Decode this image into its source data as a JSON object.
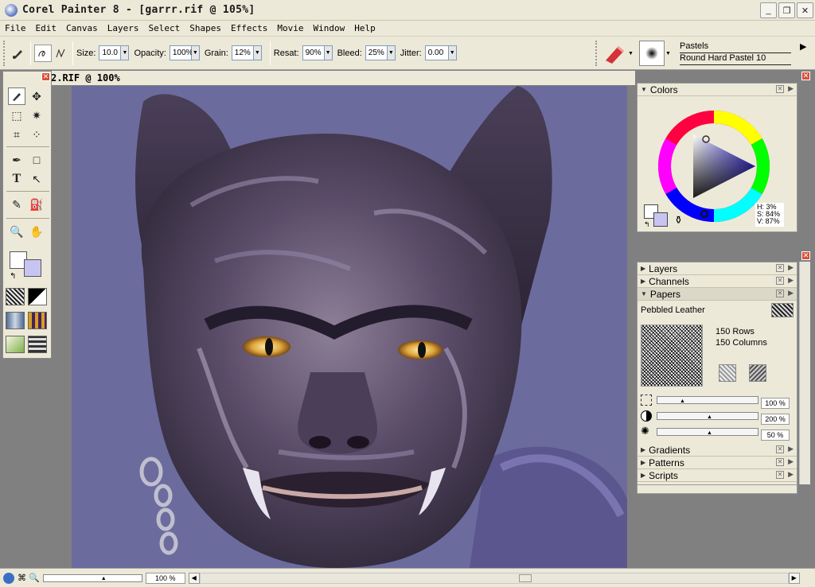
{
  "app": {
    "title": "Corel Painter 8 - [garrr.rif @ 105%]",
    "window_buttons": [
      "_",
      "❐",
      "✕"
    ]
  },
  "menu": [
    "File",
    "Edit",
    "Canvas",
    "Layers",
    "Select",
    "Shapes",
    "Effects",
    "Movie",
    "Window",
    "Help"
  ],
  "properties": {
    "size_label": "Size:",
    "size_value": "10.0",
    "opacity_label": "Opacity:",
    "opacity_value": "100%",
    "grain_label": "Grain:",
    "grain_value": "12%",
    "resat_label": "Resat:",
    "resat_value": "90%",
    "bleed_label": "Bleed:",
    "bleed_value": "25%",
    "jitter_label": "Jitter:",
    "jitter_value": "0.00"
  },
  "brush": {
    "category": "Pastels",
    "variant": "Round Hard Pastel 10"
  },
  "document": {
    "title": "2.RIF @ 100%"
  },
  "colors_panel": {
    "title": "Colors",
    "hue": "H: 3%",
    "sat": "S: 84%",
    "val": "V: 87%",
    "main_color": "#ffffff",
    "additional_color": "#c8c4f2"
  },
  "panels": {
    "layers": "Layers",
    "channels": "Channels",
    "papers": "Papers",
    "paper_name": "Pebbled Leather",
    "rows": "150 Rows",
    "columns": "150 Columns",
    "scale_value": "100 %",
    "contrast_value": "200 %",
    "brightness_value": "50 %",
    "gradients": "Gradients",
    "patterns": "Patterns",
    "scripts": "Scripts"
  },
  "status": {
    "zoom": "100 %"
  }
}
